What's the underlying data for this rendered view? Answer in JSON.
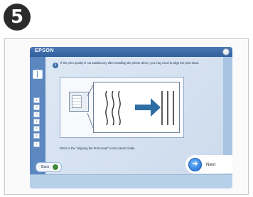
{
  "step": {
    "number": "5"
  },
  "app": {
    "brand": "EPSON",
    "message": "If the print quality is not satisfactory after installing the printer driver, you may need to align the print head.",
    "reference": "Refer to the \"Aligning the Print Head\" in the User's Guide.",
    "nav_items": [
      "1",
      "2",
      "3",
      "4",
      "5",
      "6",
      "7"
    ],
    "back_label": "Back",
    "next_label": "Next",
    "colors": {
      "titlebar": "#2f5f9e",
      "accent": "#1e6fd1",
      "back_green": "#3f8a3a"
    }
  }
}
